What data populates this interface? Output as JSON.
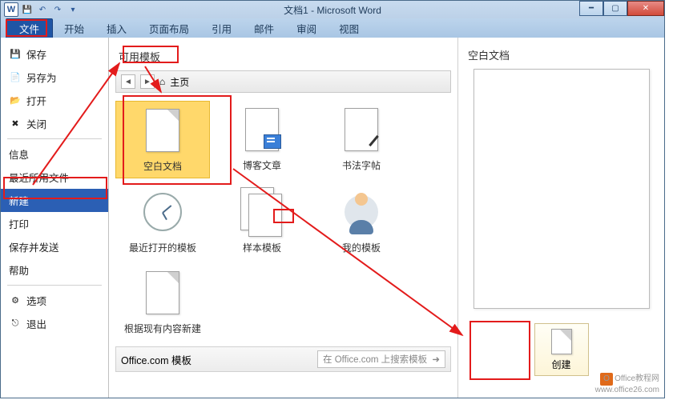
{
  "title": "文档1 - Microsoft Word",
  "ribbon": [
    "文件",
    "开始",
    "插入",
    "页面布局",
    "引用",
    "邮件",
    "审阅",
    "视图"
  ],
  "side": {
    "save": "保存",
    "saveas": "另存为",
    "open": "打开",
    "close": "关闭",
    "info": "信息",
    "recent": "最近所用文件",
    "new": "新建",
    "print": "打印",
    "saveSend": "保存并发送",
    "help": "帮助",
    "options": "选项",
    "exit": "退出"
  },
  "section": {
    "available": "可用模板",
    "home": "主页",
    "officecom": "Office.com 模板",
    "searchPlaceholder": "在 Office.com 上搜索模板"
  },
  "templates": [
    "空白文档",
    "博客文章",
    "书法字帖",
    "最近打开的模板",
    "样本模板",
    "我的模板",
    "根据现有内容新建"
  ],
  "preview": {
    "title": "空白文档",
    "create": "创建"
  },
  "watermark": {
    "brand": "Office教程网",
    "url": "www.office26.com"
  }
}
